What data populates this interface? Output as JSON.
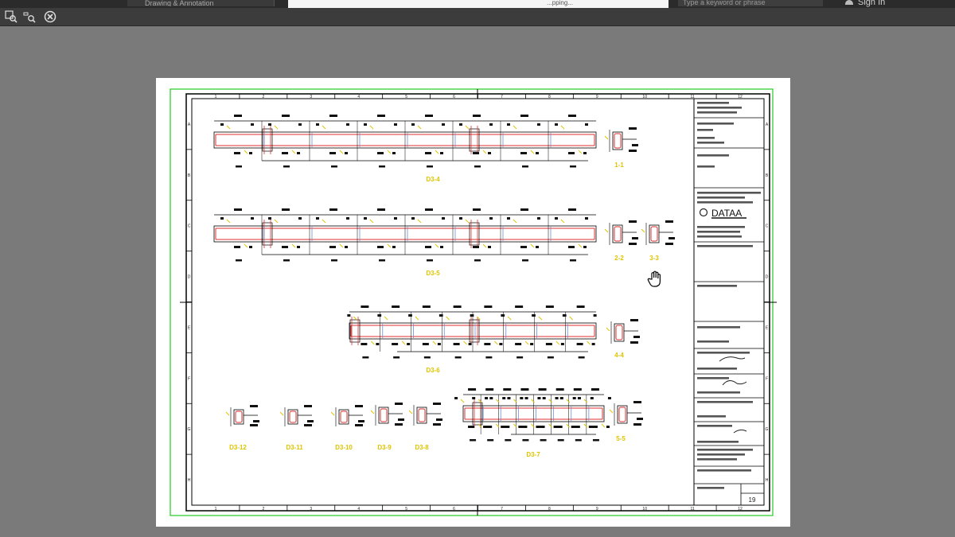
{
  "topbar": {
    "doc_tab_label": "Drawing & Annotation",
    "address_fragment": "...pping...",
    "search_placeholder": "Type a keyword or phrase",
    "signin_label": "Sign In"
  },
  "toolbar": {
    "icons": [
      "zoom-select-icon",
      "zoom-out-icon",
      "close-circle-icon"
    ]
  },
  "drawing": {
    "frame_color": "#22cc22",
    "rebar_color": "#e03030",
    "label_color": "#e0c400",
    "grid_columns": [
      "1",
      "2",
      "3",
      "4",
      "5",
      "6",
      "7",
      "8",
      "9",
      "10",
      "11",
      "12"
    ],
    "grid_rows": [
      "A",
      "B",
      "C",
      "D",
      "E",
      "F",
      "G",
      "H"
    ],
    "beam_labels": {
      "d3_4": "D3-4",
      "d3_5": "D3-5",
      "d3_6": "D3-6",
      "d3_7": "D3-7"
    },
    "section_labels": {
      "s1_1": "1-1",
      "s2_2": "2-2",
      "s3_3": "3-3",
      "s4_4": "4-4",
      "s5_5": "5-5",
      "d3_12": "D3-12",
      "d3_11": "D3-11",
      "d3_10": "D3-10",
      "d3_9": "D3-9",
      "d3_8": "D3-8"
    },
    "title_block": {
      "logo_text": "DATAA",
      "sheet_number": "19"
    }
  }
}
